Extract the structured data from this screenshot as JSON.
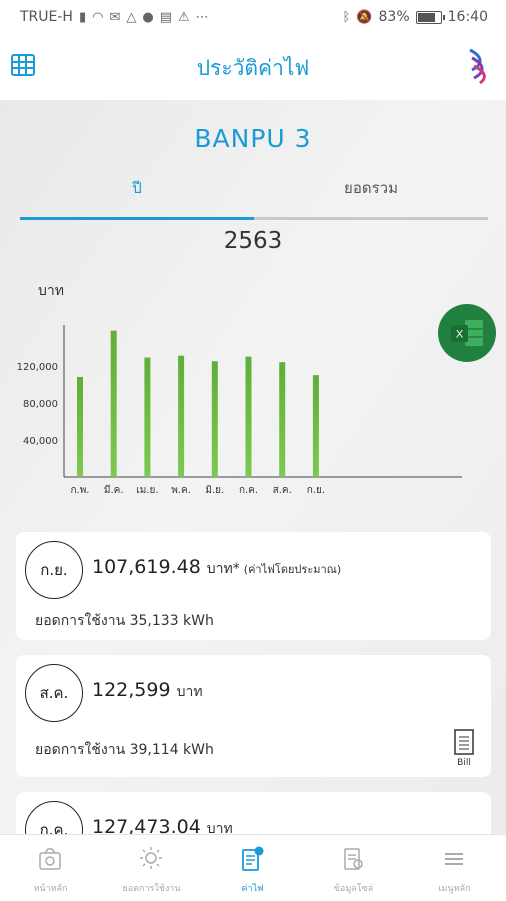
{
  "status_bar": {
    "carrier": "TRUE-H",
    "battery": "83%",
    "battery_level": 0.83,
    "time": "16:40",
    "icons": [
      "signal-icon",
      "wifi-icon",
      "mail-icon",
      "drive-icon",
      "chat-icon",
      "gallery-icon",
      "warning-icon",
      "more-icon",
      "bluetooth-icon",
      "mute-icon",
      "battery-icon"
    ]
  },
  "header": {
    "title": "ประวัติค่าไฟ",
    "left_icon": "building-grid-icon",
    "right_icon": "banpu-logo"
  },
  "site_name": "BANPU 3",
  "tabs": [
    {
      "label": "ปี",
      "active": true
    },
    {
      "label": "ยอดรวม",
      "active": false
    }
  ],
  "year": "2563",
  "excel_button": {
    "label": "X",
    "icon": "excel-icon"
  },
  "chart_data": {
    "type": "bar",
    "ylabel": "บาท",
    "categories": [
      "ก.พ.",
      "มี.ค.",
      "เม.ย.",
      "พ.ค.",
      "มิ.ย.",
      "ก.ค.",
      "ส.ค.",
      "ก.ย."
    ],
    "values": [
      108000,
      158000,
      129000,
      131000,
      125000,
      130000,
      124000,
      110000
    ],
    "yticks": [
      "40,000",
      "80,000",
      "120,000"
    ],
    "ytick_values": [
      40000,
      80000,
      120000
    ],
    "ylim": [
      0,
      162000
    ],
    "bar_color": "#7ec850",
    "grid": false
  },
  "records": [
    {
      "month": "ก.ย.",
      "amount": "107,619.48",
      "unit": "บาท*",
      "note": "(ค่าไฟโดยประมาณ)",
      "usage": "ยอดการใช้งาน 35,133 kWh",
      "bill": false
    },
    {
      "month": "ส.ค.",
      "amount": "122,599",
      "unit": "บาท",
      "note": "",
      "usage": "ยอดการใช้งาน 39,114 kWh",
      "bill": true,
      "bill_label": "Bill"
    },
    {
      "month": "ก.ค.",
      "amount": "127,473.04",
      "unit": "บาท",
      "note": "",
      "usage": "",
      "bill": false
    }
  ],
  "bottom_nav": [
    {
      "label": "หน้าหลัก",
      "icon": "home-camera-icon",
      "active": false
    },
    {
      "label": "ยอดการใช้งาน",
      "icon": "sun-energy-icon",
      "active": false
    },
    {
      "label": "ค่าไฟ",
      "icon": "bill-icon",
      "active": true
    },
    {
      "label": "ข้อมูลโซล่",
      "icon": "solar-info-icon",
      "active": false
    },
    {
      "label": "เมนูหลัก",
      "icon": "menu-icon",
      "active": false
    }
  ],
  "colors": {
    "accent": "#1a9bd7",
    "bar": "#7ec850",
    "excel": "#22803e"
  }
}
